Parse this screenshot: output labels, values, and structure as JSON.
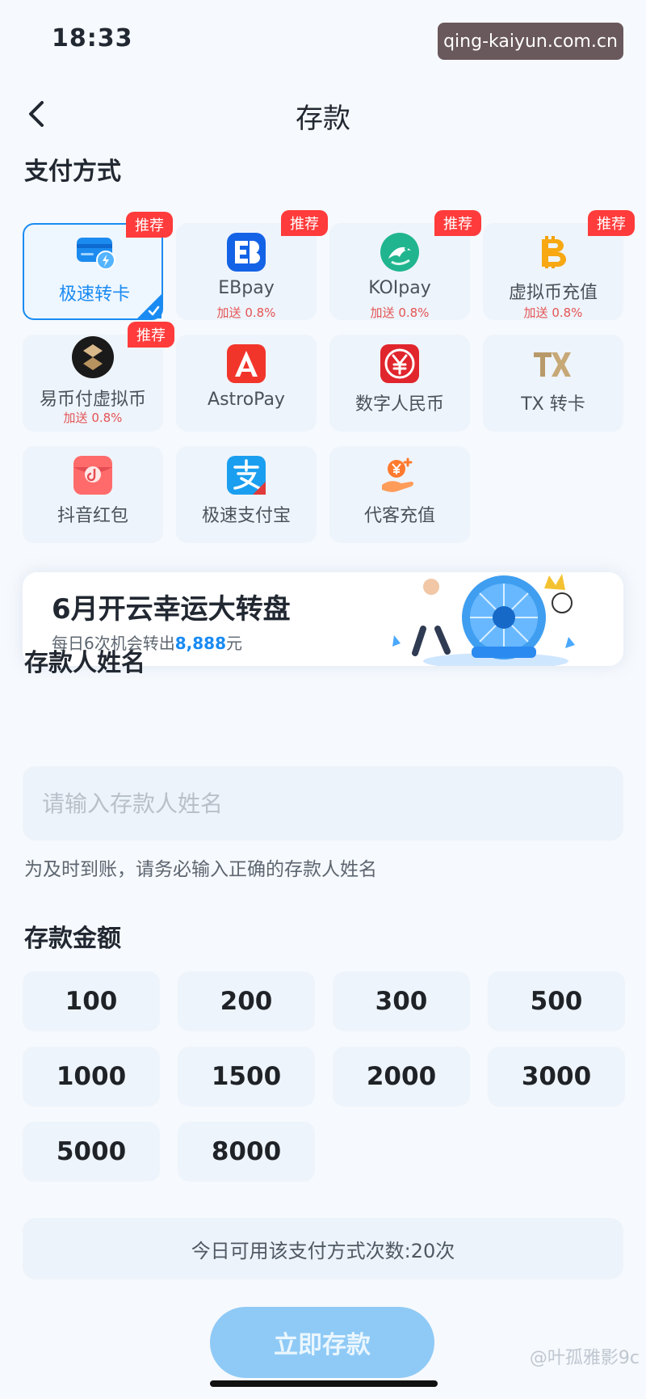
{
  "status_bar": {
    "time": "18:33",
    "watermark": "qing-kaiyun.com.cn"
  },
  "nav": {
    "back_icon": "chevron-left-icon",
    "title": "存款"
  },
  "sections": {
    "payment": "支付方式",
    "depositor_name": "存款人姓名",
    "amount": "存款金额"
  },
  "payment_methods": [
    {
      "name": "极速转卡",
      "icon": "card-transfer-icon",
      "recommended": true,
      "bonus": "",
      "selected": true
    },
    {
      "name": "EBpay",
      "icon": "ebpay-icon",
      "recommended": true,
      "bonus": "加送 0.8%",
      "selected": false
    },
    {
      "name": "KOIpay",
      "icon": "koipay-icon",
      "recommended": true,
      "bonus": "加送 0.8%",
      "selected": false
    },
    {
      "name": "虚拟币充值",
      "icon": "bitcoin-icon",
      "recommended": true,
      "bonus": "加送 0.8%",
      "selected": false
    },
    {
      "name": "易币付虚拟币",
      "icon": "ebifu-icon",
      "recommended": true,
      "bonus": "加送 0.8%",
      "selected": false
    },
    {
      "name": "AstroPay",
      "icon": "astropay-icon",
      "recommended": false,
      "bonus": "",
      "selected": false
    },
    {
      "name": "数字人民币",
      "icon": "digital-rmb-icon",
      "recommended": false,
      "bonus": "",
      "selected": false
    },
    {
      "name": "TX 转卡",
      "icon": "tx-transfer-icon",
      "recommended": false,
      "bonus": "",
      "selected": false
    },
    {
      "name": "抖音红包",
      "icon": "douyin-redpacket-icon",
      "recommended": false,
      "bonus": "",
      "selected": false
    },
    {
      "name": "极速支付宝",
      "icon": "alipay-icon",
      "recommended": false,
      "bonus": "",
      "selected": false
    },
    {
      "name": "代客充值",
      "icon": "agent-recharge-icon",
      "recommended": false,
      "bonus": "",
      "selected": false
    }
  ],
  "labels": {
    "recommend_tag": "推荐"
  },
  "banner": {
    "title": "6月开云幸运大转盘",
    "subtitle_prefix": "每日6次机会转出",
    "subtitle_highlight": "8,888",
    "subtitle_suffix": "元",
    "art_icon": "lucky-wheel-icon"
  },
  "depositor": {
    "placeholder": "请输入存款人姓名",
    "value": "",
    "hint": "为及时到账，请务必输入正确的存款人姓名"
  },
  "amounts": [
    "100",
    "200",
    "300",
    "500",
    "1000",
    "1500",
    "2000",
    "3000",
    "5000",
    "8000"
  ],
  "usage": {
    "text": "今日可用该支付方式次数:20次"
  },
  "submit": {
    "label": "立即存款"
  },
  "watermark_bottom": "@叶孤雅影9c",
  "colors": {
    "accent": "#1a8bf2",
    "tag": "#ff3b3b",
    "button": "#8fcaf6",
    "background": "#f6f9fd",
    "card": "#eef4fb"
  }
}
